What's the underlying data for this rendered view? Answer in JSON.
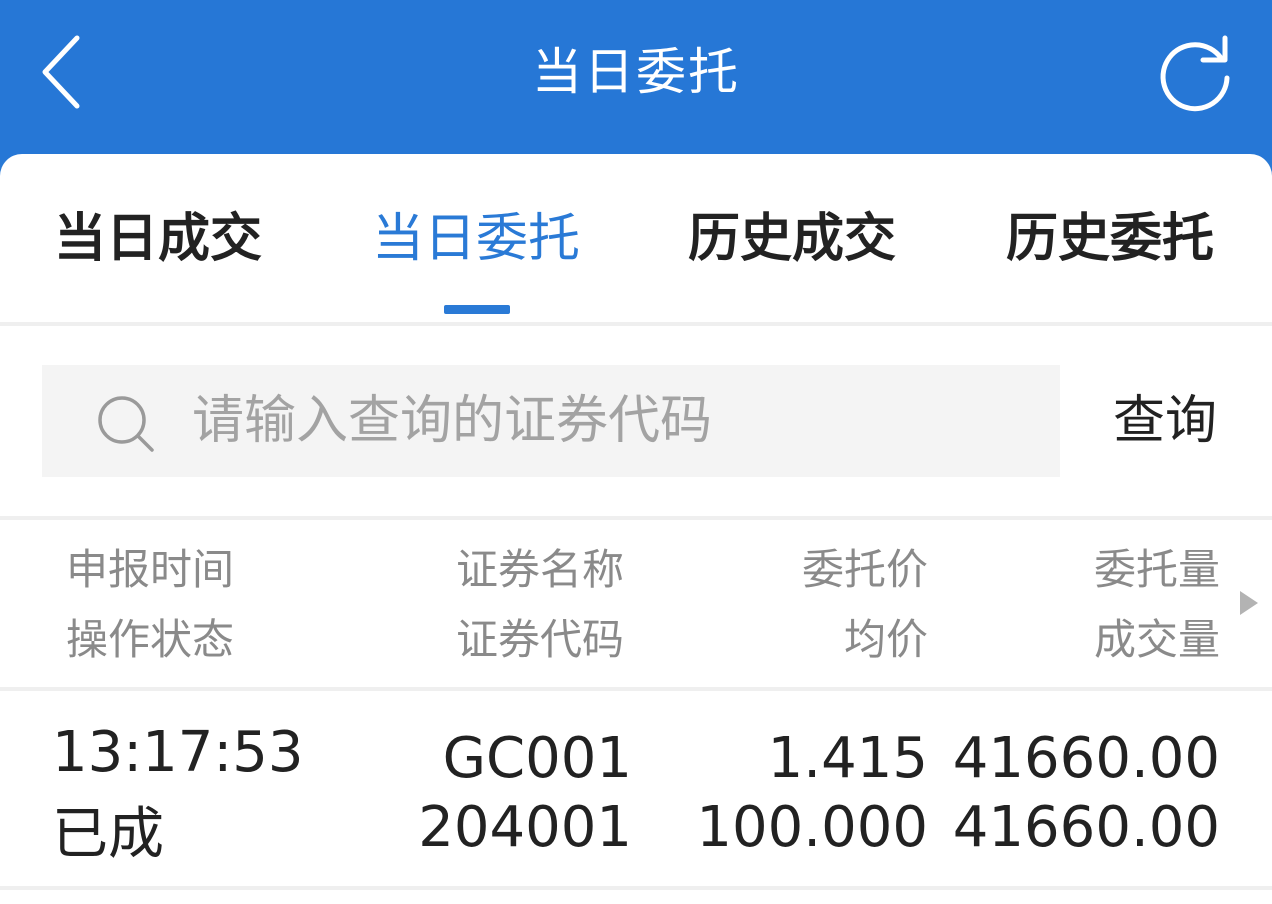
{
  "header": {
    "title": "当日委托",
    "back_icon": "chevron-left-icon",
    "refresh_icon": "refresh-icon",
    "background": "#2677d6"
  },
  "tabs": [
    {
      "label": "当日成交",
      "active": false
    },
    {
      "label": "当日委托",
      "active": true
    },
    {
      "label": "历史成交",
      "active": false
    },
    {
      "label": "历史委托",
      "active": false
    }
  ],
  "search": {
    "placeholder": "请输入查询的证券代码",
    "value": "",
    "button_label": "查询"
  },
  "table": {
    "columns": [
      {
        "line1": "申报时间",
        "line2": "操作状态"
      },
      {
        "line1": "证券名称",
        "line2": "证券代码"
      },
      {
        "line1": "委托价",
        "line2": "均价"
      },
      {
        "line1": "委托量",
        "line2": "成交量"
      }
    ],
    "rows": [
      {
        "time": "13:17:53",
        "status": "已成",
        "name": "GC001",
        "code": "204001",
        "price": "1.415",
        "avg_price": "100.000",
        "order_qty": "41660.00",
        "filled_qty": "41660.00"
      }
    ]
  },
  "colors": {
    "accent": "#2a7ad6",
    "text": "#222222",
    "muted": "#8a8a8a"
  }
}
